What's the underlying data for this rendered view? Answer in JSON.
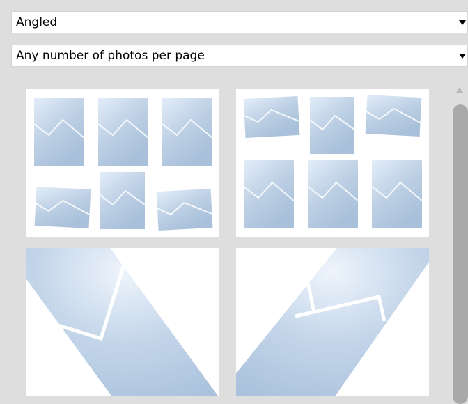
{
  "layout_style_select": {
    "value": "Angled"
  },
  "photos_per_page_select": {
    "value": "Any number of photos per page"
  },
  "templates": [
    {
      "name": "six-photos-mixed-tilt-a",
      "photo_count": 6
    },
    {
      "name": "six-photos-mixed-tilt-b",
      "photo_count": 6
    },
    {
      "name": "single-photo-tilted-left",
      "photo_count": 1
    },
    {
      "name": "single-photo-tilted-right",
      "photo_count": 1
    }
  ],
  "icons": {
    "dropdown": "chevron-down-icon",
    "scroll_up": "arrow-up-icon",
    "photo": "photo-placeholder-icon"
  },
  "colors": {
    "photo_light": "#e2ecf8",
    "photo_mid": "#b9cde3",
    "photo_dark": "#9fb9d6"
  }
}
